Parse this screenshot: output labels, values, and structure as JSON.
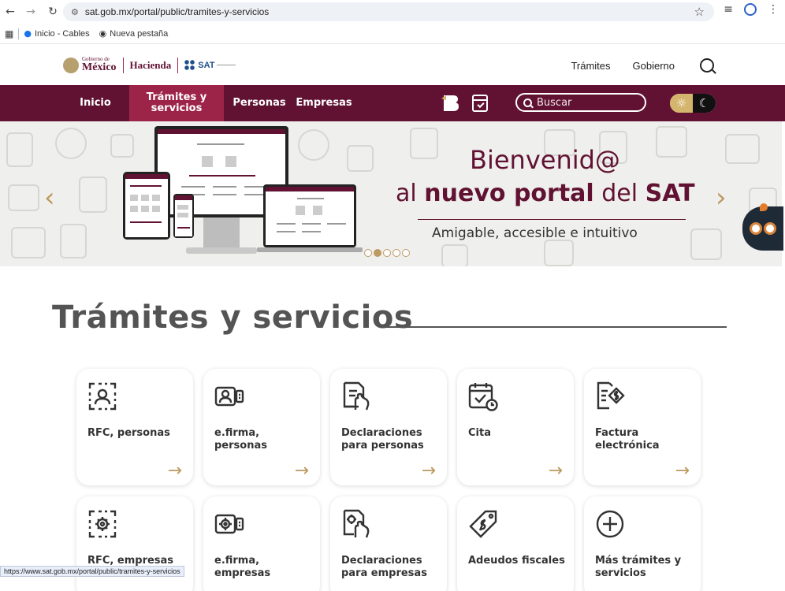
{
  "browser": {
    "url": "sat.gob.mx/portal/public/tramites-y-servicios",
    "bookmarks": [
      "Inicio - Cables",
      "Nueva pestaña"
    ]
  },
  "gob_header": {
    "mexico_small": "Gobierno de",
    "mexico_big": "México",
    "hacienda": "Hacienda",
    "sat": "SAT",
    "nav": [
      "Trámites",
      "Gobierno"
    ]
  },
  "sat_nav": {
    "inicio": "Inicio",
    "tramites_line1": "Trámites y",
    "tramites_line2": "servicios",
    "personas": "Personas",
    "empresas": "Empresas",
    "search_placeholder": "Buscar"
  },
  "hero": {
    "title": "Bienvenid@",
    "sub_pre": "al ",
    "sub_bold": "nuevo portal",
    "sub_mid": " del ",
    "sub_bold2": "SAT",
    "tagline": "Amigable, accesible e intuitivo",
    "slides": 5,
    "active_slide": 2
  },
  "section": {
    "title": "Trámites y servicios"
  },
  "cards_row1": [
    {
      "label": "RFC, personas",
      "icon": "rfc-person-icon"
    },
    {
      "label": "e.firma, personas",
      "icon": "id-card-icon"
    },
    {
      "label": "Declaraciones para personas",
      "icon": "declaration-icon"
    },
    {
      "label": "Cita",
      "icon": "calendar-clock-icon"
    },
    {
      "label": "Factura electrónica",
      "icon": "invoice-icon"
    }
  ],
  "cards_row2": [
    {
      "label": "RFC, empresas",
      "icon": "rfc-gear-icon"
    },
    {
      "label": "e.firma, empresas",
      "icon": "id-card-gear-icon"
    },
    {
      "label": "Declaraciones para empresas",
      "icon": "declaration-gear-icon"
    },
    {
      "label": "Adeudos fiscales",
      "icon": "tag-money-icon"
    },
    {
      "label": "Más trámites y servicios",
      "icon": "plus-circle-icon"
    }
  ],
  "arrow_glyph": "→",
  "status_url": "https://www.sat.gob.mx/portal/public/tramites-y-servicios",
  "colors": {
    "guinda": "#611232",
    "guinda_light": "#9d2449",
    "gold": "#bd9a61"
  }
}
